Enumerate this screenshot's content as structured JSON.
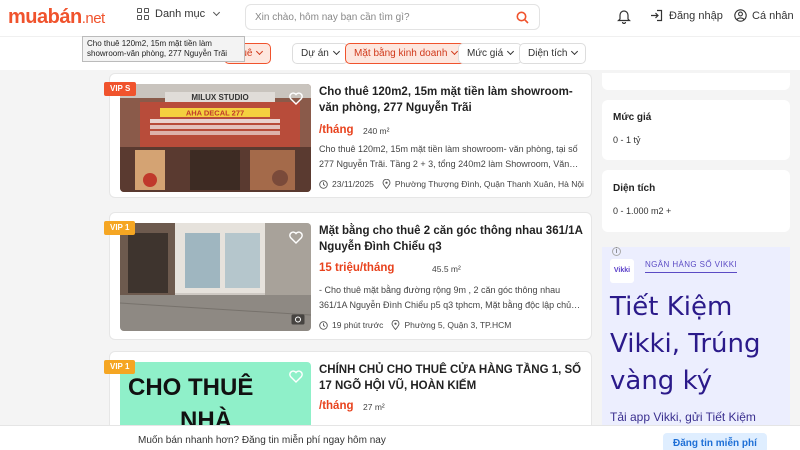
{
  "header": {
    "logo_main": "muabán",
    "logo_tld": ".net",
    "categories_label": "Danh mục",
    "search_placeholder": "Xin chào, hôm nay bạn cần tìm gì?",
    "login_label": "Đăng nhập",
    "account_label": "Cá nhân"
  },
  "tooltip": "Cho thuê 120m2, 15m mặt tiền làm showroom-văn phòng, 277 Nguyễn Trãi",
  "filters": [
    {
      "label": "thuê",
      "active": true
    },
    {
      "label": "Dự án",
      "active": false
    },
    {
      "label": "Mặt bằng kinh doanh",
      "active": true
    },
    {
      "label": "Mức giá",
      "active": false
    },
    {
      "label": "Diện tích",
      "active": false
    }
  ],
  "listings": [
    {
      "vip": "VIP S",
      "vip_color": "#f0532d",
      "title": "Cho thuê 120m2, 15m mặt tiền làm showroom-văn phòng, 277 Nguyễn Trãi",
      "price": "/tháng",
      "area": "240 m²",
      "desc": "Cho thuê 120m2, 15m mặt tiền làm showroom- văn phòng, tại số 277 Nguyễn Trãi. Tầng 2 + 3, tổng 240m2 làm Showroom, Văn…",
      "date": "23/11/2025",
      "location": "Phường Thượng Đình, Quận Thanh Xuân, Hà Nội",
      "sign_top": "MILUX STUDIO",
      "sign_mid": "AHA DECAL 277"
    },
    {
      "vip": "VIP 1",
      "vip_color": "#f5a623",
      "title": "Mặt bằng cho thuê 2 căn góc thông nhau 361/1A Nguyễn Đình Chiểu q3",
      "price": "15 triệu/tháng",
      "area": "45.5 m²",
      "desc": "- Cho thuê mặt bằng đường rộng 9m , 2 căn góc thông nhau 361/1A Nguyễn Đình Chiểu p5 q3 tphcm, Mặt bằng độc lập chủ…",
      "date": "19 phút trước",
      "location": "Phường 5, Quận 3, TP.HCM"
    },
    {
      "vip": "VIP 1",
      "vip_color": "#f5a623",
      "title": "CHÍNH CHỦ CHO THUÊ CỬA HÀNG TẦNG 1, SỐ 17 NGÕ HỘI VŨ, HOÀN KIẾM",
      "price": "/tháng",
      "area": "27 m²",
      "sign_line1": "CHO THUÊ",
      "sign_line2": "NHÀ"
    }
  ],
  "sidebar": {
    "price_heading": "Mức giá",
    "price_item": "0 - 1 tỷ",
    "area_heading": "Diện tích",
    "area_item": "0 - 1.000 m2 +"
  },
  "ad": {
    "badge": "i",
    "logo": "Vikki",
    "bank": "NGÂN HÀNG SỐ VIKKI",
    "headline": "Tiết Kiệm Vikki, Trúng vàng ký",
    "sub": "Tải app Vikki, gửi Tiết Kiệm"
  },
  "bottom": {
    "text": "Muốn bán nhanh hơn? Đăng tin miễn phí ngay hôm nay",
    "button": "Đăng tin miễn phí"
  }
}
